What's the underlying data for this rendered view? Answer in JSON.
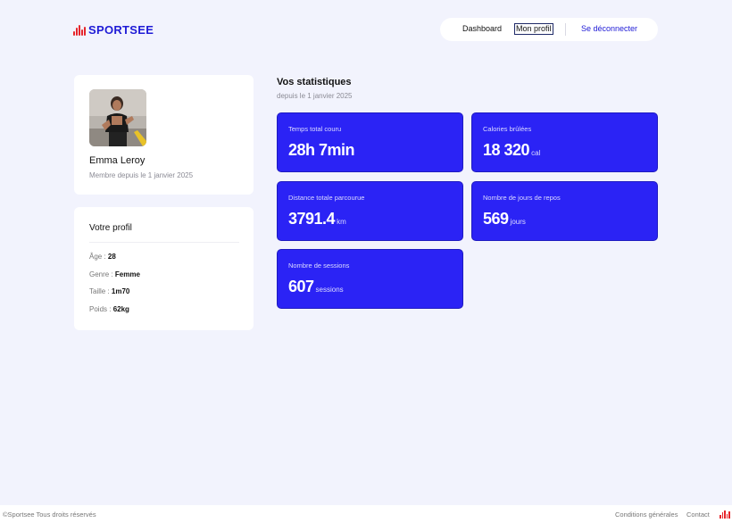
{
  "brand": {
    "name": "SPORTSEE",
    "primary_color": "#2b23f5",
    "accent_color": "#e6252b"
  },
  "nav": {
    "dashboard": "Dashboard",
    "profile": "Mon profil",
    "logout": "Se déconnecter"
  },
  "profile": {
    "name": "Emma Leroy",
    "member_since": "Membre depuis le 1 janvier 2025"
  },
  "details": {
    "title": "Votre profil",
    "rows": [
      {
        "label": "Âge : ",
        "value": "28"
      },
      {
        "label": "Genre : ",
        "value": "Femme"
      },
      {
        "label": "Taille : ",
        "value": "1m70"
      },
      {
        "label": "Poids : ",
        "value": "62kg"
      }
    ]
  },
  "stats": {
    "title": "Vos statistiques",
    "subtitle": "depuis le 1 janvier 2025",
    "items": [
      {
        "label": "Temps total couru",
        "value": "28h 7min",
        "unit": ""
      },
      {
        "label": "Calories brûlées",
        "value": "18 320",
        "unit": "cal"
      },
      {
        "label": "Distance totale parcourue",
        "value": "3791.4",
        "unit": "km"
      },
      {
        "label": "Nombre de jours de repos",
        "value": "569",
        "unit": "jours"
      },
      {
        "label": "Nombre de sessions",
        "value": "607",
        "unit": "sessions"
      }
    ]
  },
  "footer": {
    "copyright": "©Sportsee Tous droits réservés",
    "terms": "Conditions générales",
    "contact": "Contact"
  },
  "icons": {
    "logo": "heartbeat-bars-icon",
    "avatar": "user-photo"
  }
}
